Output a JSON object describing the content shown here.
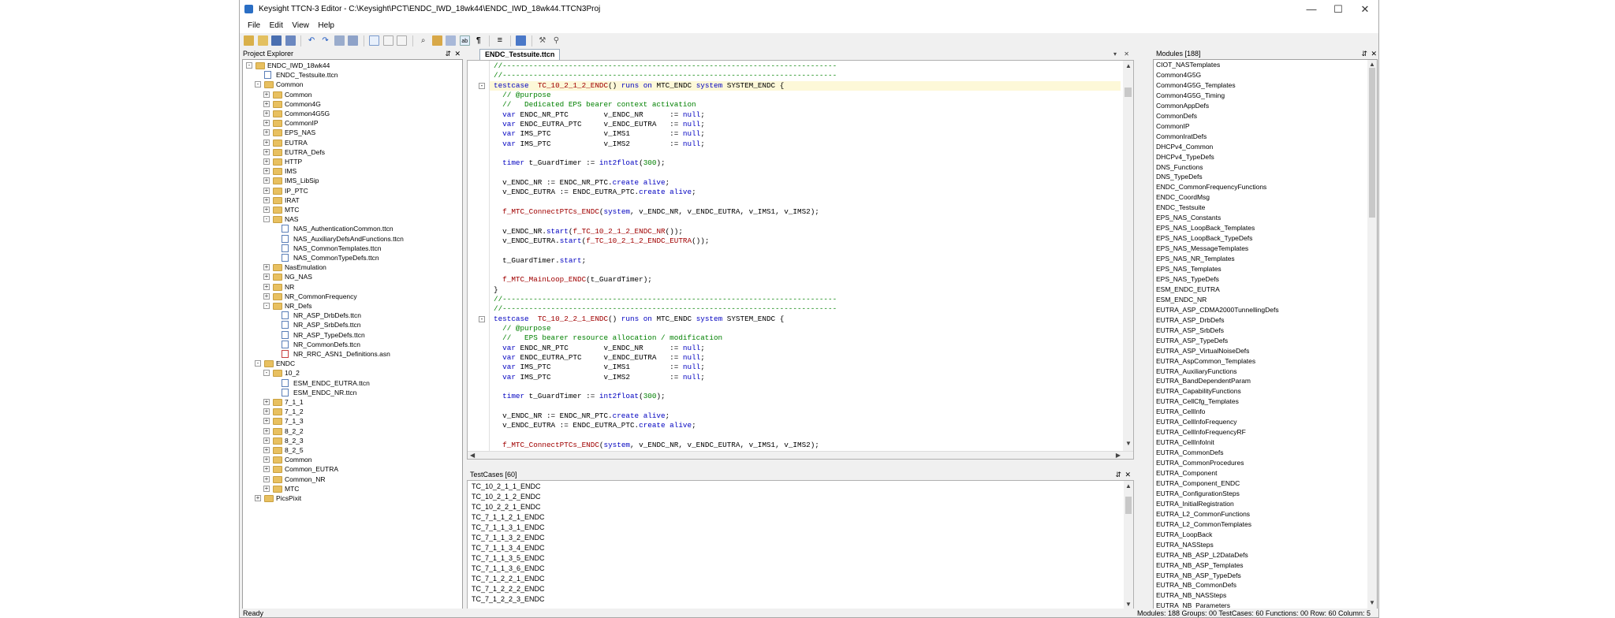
{
  "window": {
    "title": "Keysight TTCN-3 Editor - C:\\Keysight\\PCT\\ENDC_IWD_18wk44\\ENDC_IWD_18wk44.TTCN3Proj"
  },
  "menu": [
    "File",
    "Edit",
    "View",
    "Help"
  ],
  "project_explorer": {
    "title": "Project Explorer",
    "pin": "⇵",
    "close": "✕",
    "nodes": [
      {
        "label": "ENDC_IWD_18wk44",
        "depth": 0,
        "kind": "folder",
        "exp": "-"
      },
      {
        "label": "ENDC_Testsuite.ttcn",
        "depth": 1,
        "kind": "file",
        "exp": ""
      },
      {
        "label": "Common",
        "depth": 1,
        "kind": "folder",
        "exp": "-"
      },
      {
        "label": "Common",
        "depth": 2,
        "kind": "folder",
        "exp": "+"
      },
      {
        "label": "Common4G",
        "depth": 2,
        "kind": "folder",
        "exp": "+"
      },
      {
        "label": "Common4G5G",
        "depth": 2,
        "kind": "folder",
        "exp": "+"
      },
      {
        "label": "CommonIP",
        "depth": 2,
        "kind": "folder",
        "exp": "+"
      },
      {
        "label": "EPS_NAS",
        "depth": 2,
        "kind": "folder",
        "exp": "+"
      },
      {
        "label": "EUTRA",
        "depth": 2,
        "kind": "folder",
        "exp": "+"
      },
      {
        "label": "EUTRA_Defs",
        "depth": 2,
        "kind": "folder",
        "exp": "+"
      },
      {
        "label": "HTTP",
        "depth": 2,
        "kind": "folder",
        "exp": "+"
      },
      {
        "label": "IMS",
        "depth": 2,
        "kind": "folder",
        "exp": "+"
      },
      {
        "label": "IMS_LibSip",
        "depth": 2,
        "kind": "folder",
        "exp": "+"
      },
      {
        "label": "IP_PTC",
        "depth": 2,
        "kind": "folder",
        "exp": "+"
      },
      {
        "label": "IRAT",
        "depth": 2,
        "kind": "folder",
        "exp": "+"
      },
      {
        "label": "MTC",
        "depth": 2,
        "kind": "folder",
        "exp": "+"
      },
      {
        "label": "NAS",
        "depth": 2,
        "kind": "folder",
        "exp": "-"
      },
      {
        "label": "NAS_AuthenticationCommon.ttcn",
        "depth": 3,
        "kind": "file",
        "exp": ""
      },
      {
        "label": "NAS_AuxiliaryDefsAndFunctions.ttcn",
        "depth": 3,
        "kind": "file",
        "exp": ""
      },
      {
        "label": "NAS_CommonTemplates.ttcn",
        "depth": 3,
        "kind": "file",
        "exp": ""
      },
      {
        "label": "NAS_CommonTypeDefs.ttcn",
        "depth": 3,
        "kind": "file",
        "exp": ""
      },
      {
        "label": "NasEmulation",
        "depth": 2,
        "kind": "folder",
        "exp": "+"
      },
      {
        "label": "NG_NAS",
        "depth": 2,
        "kind": "folder",
        "exp": "+"
      },
      {
        "label": "NR",
        "depth": 2,
        "kind": "folder",
        "exp": "+"
      },
      {
        "label": "NR_CommonFrequency",
        "depth": 2,
        "kind": "folder",
        "exp": "+"
      },
      {
        "label": "NR_Defs",
        "depth": 2,
        "kind": "folder",
        "exp": "-"
      },
      {
        "label": "NR_ASP_DrbDefs.ttcn",
        "depth": 3,
        "kind": "file",
        "exp": ""
      },
      {
        "label": "NR_ASP_SrbDefs.ttcn",
        "depth": 3,
        "kind": "file",
        "exp": ""
      },
      {
        "label": "NR_ASP_TypeDefs.ttcn",
        "depth": 3,
        "kind": "file",
        "exp": ""
      },
      {
        "label": "NR_CommonDefs.ttcn",
        "depth": 3,
        "kind": "file",
        "exp": ""
      },
      {
        "label": "NR_RRC_ASN1_Definitions.asn",
        "depth": 3,
        "kind": "asn",
        "exp": ""
      },
      {
        "label": "ENDC",
        "depth": 1,
        "kind": "folder",
        "exp": "-"
      },
      {
        "label": "10_2",
        "depth": 2,
        "kind": "folder",
        "exp": "-"
      },
      {
        "label": "ESM_ENDC_EUTRA.ttcn",
        "depth": 3,
        "kind": "file",
        "exp": ""
      },
      {
        "label": "ESM_ENDC_NR.ttcn",
        "depth": 3,
        "kind": "file",
        "exp": ""
      },
      {
        "label": "7_1_1",
        "depth": 2,
        "kind": "folder",
        "exp": "+"
      },
      {
        "label": "7_1_2",
        "depth": 2,
        "kind": "folder",
        "exp": "+"
      },
      {
        "label": "7_1_3",
        "depth": 2,
        "kind": "folder",
        "exp": "+"
      },
      {
        "label": "8_2_2",
        "depth": 2,
        "kind": "folder",
        "exp": "+"
      },
      {
        "label": "8_2_3",
        "depth": 2,
        "kind": "folder",
        "exp": "+"
      },
      {
        "label": "8_2_5",
        "depth": 2,
        "kind": "folder",
        "exp": "+"
      },
      {
        "label": "Common",
        "depth": 2,
        "kind": "folder",
        "exp": "+"
      },
      {
        "label": "Common_EUTRA",
        "depth": 2,
        "kind": "folder",
        "exp": "+"
      },
      {
        "label": "Common_NR",
        "depth": 2,
        "kind": "folder",
        "exp": "+"
      },
      {
        "label": "MTC",
        "depth": 2,
        "kind": "folder",
        "exp": "+"
      },
      {
        "label": "PicsPixit",
        "depth": 1,
        "kind": "folder",
        "exp": "+"
      }
    ]
  },
  "editor": {
    "tab": "ENDC_Testsuite.ttcn",
    "tab_dropdown": "▾",
    "tab_close": "✕",
    "lines": [
      [
        [
          "cm",
          "//----------------------------------------------------------------------------"
        ]
      ],
      [
        [
          "cm",
          "//----------------------------------------------------------------------------"
        ]
      ],
      [
        [
          "kw",
          "testcase"
        ],
        [
          "",
          "  "
        ],
        [
          "fn",
          "TC_10_2_1_2_ENDC"
        ],
        [
          "",
          "() "
        ],
        [
          "kw",
          "runs on"
        ],
        [
          "",
          ""
        ],
        [
          "kw",
          " "
        ],
        [
          "",
          "MTC_ENDC "
        ],
        [
          "kw",
          "system"
        ],
        [
          "",
          " SYSTEM_ENDC {"
        ]
      ],
      [
        [
          "cm",
          "  // @purpose"
        ]
      ],
      [
        [
          "cm",
          "  //   Dedicated EPS bearer context activation"
        ]
      ],
      [
        [
          "kw",
          "  var"
        ],
        [
          "",
          " ENDC_NR_PTC        v_ENDC_NR      := "
        ],
        [
          "kw",
          "null"
        ],
        [
          "",
          ";"
        ]
      ],
      [
        [
          "kw",
          "  var"
        ],
        [
          "",
          " ENDC_EUTRA_PTC     v_ENDC_EUTRA   := "
        ],
        [
          "kw",
          "null"
        ],
        [
          "",
          ";"
        ]
      ],
      [
        [
          "kw",
          "  var"
        ],
        [
          "",
          " IMS_PTC            v_IMS1         := "
        ],
        [
          "kw",
          "null"
        ],
        [
          "",
          ";"
        ]
      ],
      [
        [
          "kw",
          "  var"
        ],
        [
          "",
          " IMS_PTC            v_IMS2         := "
        ],
        [
          "kw",
          "null"
        ],
        [
          "",
          ";"
        ]
      ],
      [
        [
          "",
          ""
        ]
      ],
      [
        [
          "kw",
          "  timer"
        ],
        [
          "",
          " t_GuardTimer := "
        ],
        [
          "kw",
          "int2float"
        ],
        [
          "",
          "("
        ],
        [
          "cm",
          "300"
        ],
        [
          "",
          ");"
        ]
      ],
      [
        [
          "",
          ""
        ]
      ],
      [
        [
          "",
          "  v_ENDC_NR := ENDC_NR_PTC."
        ],
        [
          "kw",
          "create alive"
        ],
        [
          "",
          ";"
        ]
      ],
      [
        [
          "",
          "  v_ENDC_EUTRA := ENDC_EUTRA_PTC."
        ],
        [
          "kw",
          "create alive"
        ],
        [
          "",
          ";"
        ]
      ],
      [
        [
          "",
          ""
        ]
      ],
      [
        [
          "fn",
          "  f_MTC_ConnectPTCs_ENDC"
        ],
        [
          "",
          "("
        ],
        [
          "kw",
          "system"
        ],
        [
          "",
          ", v_ENDC_NR, v_ENDC_EUTRA, v_IMS1, v_IMS2);"
        ]
      ],
      [
        [
          "",
          ""
        ]
      ],
      [
        [
          "",
          "  v_ENDC_NR."
        ],
        [
          "kw",
          "start"
        ],
        [
          "",
          "("
        ],
        [
          "fn",
          "f_TC_10_2_1_2_ENDC_NR"
        ],
        [
          "",
          "());"
        ]
      ],
      [
        [
          "",
          "  v_ENDC_EUTRA."
        ],
        [
          "kw",
          "start"
        ],
        [
          "",
          "("
        ],
        [
          "fn",
          "f_TC_10_2_1_2_ENDC_EUTRA"
        ],
        [
          "",
          "());"
        ]
      ],
      [
        [
          "",
          ""
        ]
      ],
      [
        [
          "",
          "  t_GuardTimer."
        ],
        [
          "kw",
          "start"
        ],
        [
          "",
          ";"
        ]
      ],
      [
        [
          "",
          ""
        ]
      ],
      [
        [
          "fn",
          "  f_MTC_MainLoop_ENDC"
        ],
        [
          "",
          "(t_GuardTimer);"
        ]
      ],
      [
        [
          "",
          "}"
        ]
      ],
      [
        [
          "cm",
          "//----------------------------------------------------------------------------"
        ]
      ],
      [
        [
          "cm",
          "//----------------------------------------------------------------------------"
        ]
      ],
      [
        [
          "kw",
          "testcase"
        ],
        [
          "",
          "  "
        ],
        [
          "fn",
          "TC_10_2_2_1_ENDC"
        ],
        [
          "",
          "() "
        ],
        [
          "kw",
          "runs on"
        ],
        [
          "",
          " MTC_ENDC "
        ],
        [
          "kw",
          "system"
        ],
        [
          "",
          " SYSTEM_ENDC {"
        ]
      ],
      [
        [
          "cm",
          "  // @purpose"
        ]
      ],
      [
        [
          "cm",
          "  //   EPS bearer resource allocation / modification"
        ]
      ],
      [
        [
          "kw",
          "  var"
        ],
        [
          "",
          " ENDC_NR_PTC        v_ENDC_NR      := "
        ],
        [
          "kw",
          "null"
        ],
        [
          "",
          ";"
        ]
      ],
      [
        [
          "kw",
          "  var"
        ],
        [
          "",
          " ENDC_EUTRA_PTC     v_ENDC_EUTRA   := "
        ],
        [
          "kw",
          "null"
        ],
        [
          "",
          ";"
        ]
      ],
      [
        [
          "kw",
          "  var"
        ],
        [
          "",
          " IMS_PTC            v_IMS1         := "
        ],
        [
          "kw",
          "null"
        ],
        [
          "",
          ";"
        ]
      ],
      [
        [
          "kw",
          "  var"
        ],
        [
          "",
          " IMS_PTC            v_IMS2         := "
        ],
        [
          "kw",
          "null"
        ],
        [
          "",
          ";"
        ]
      ],
      [
        [
          "",
          ""
        ]
      ],
      [
        [
          "kw",
          "  timer"
        ],
        [
          "",
          " t_GuardTimer := "
        ],
        [
          "kw",
          "int2float"
        ],
        [
          "",
          "("
        ],
        [
          "cm",
          "300"
        ],
        [
          "",
          ");"
        ]
      ],
      [
        [
          "",
          ""
        ]
      ],
      [
        [
          "",
          "  v_ENDC_NR := ENDC_NR_PTC."
        ],
        [
          "kw",
          "create alive"
        ],
        [
          "",
          ";"
        ]
      ],
      [
        [
          "",
          "  v_ENDC_EUTRA := ENDC_EUTRA_PTC."
        ],
        [
          "kw",
          "create alive"
        ],
        [
          "",
          ";"
        ]
      ],
      [
        [
          "",
          ""
        ]
      ],
      [
        [
          "fn",
          "  f_MTC_ConnectPTCs_ENDC"
        ],
        [
          "",
          "("
        ],
        [
          "kw",
          "system"
        ],
        [
          "",
          ", v_ENDC_NR, v_ENDC_EUTRA, v_IMS1, v_IMS2);"
        ]
      ]
    ]
  },
  "testcases": {
    "title": "TestCases [60]",
    "items": [
      "TC_10_2_1_1_ENDC",
      "TC_10_2_1_2_ENDC",
      "TC_10_2_2_1_ENDC",
      "TC_7_1_1_2_1_ENDC",
      "TC_7_1_1_3_1_ENDC",
      "TC_7_1_1_3_2_ENDC",
      "TC_7_1_1_3_4_ENDC",
      "TC_7_1_1_3_5_ENDC",
      "TC_7_1_1_3_6_ENDC",
      "TC_7_1_2_2_1_ENDC",
      "TC_7_1_2_2_2_ENDC",
      "TC_7_1_2_2_3_ENDC"
    ]
  },
  "modules": {
    "title": "Modules [188]",
    "items": [
      "CIOT_NASTemplates",
      "Common4G5G",
      "Common4G5G_Templates",
      "Common4G5G_Timing",
      "CommonAppDefs",
      "CommonDefs",
      "CommonIP",
      "CommonIratDefs",
      "DHCPv4_Common",
      "DHCPv4_TypeDefs",
      "DNS_Functions",
      "DNS_TypeDefs",
      "ENDC_CommonFrequencyFunctions",
      "ENDC_CoordMsg",
      "ENDC_Testsuite",
      "EPS_NAS_Constants",
      "EPS_NAS_LoopBack_Templates",
      "EPS_NAS_LoopBack_TypeDefs",
      "EPS_NAS_MessageTemplates",
      "EPS_NAS_NR_Templates",
      "EPS_NAS_Templates",
      "EPS_NAS_TypeDefs",
      "ESM_ENDC_EUTRA",
      "ESM_ENDC_NR",
      "EUTRA_ASP_CDMA2000TunnellingDefs",
      "EUTRA_ASP_DrbDefs",
      "EUTRA_ASP_SrbDefs",
      "EUTRA_ASP_TypeDefs",
      "EUTRA_ASP_VirtualNoiseDefs",
      "EUTRA_AspCommon_Templates",
      "EUTRA_AuxiliaryFunctions",
      "EUTRA_BandDependentParam",
      "EUTRA_CapabilityFunctions",
      "EUTRA_CellCfg_Templates",
      "EUTRA_CellInfo",
      "EUTRA_CellInfoFrequency",
      "EUTRA_CellInfoFrequencyRF",
      "EUTRA_CellInfoInit",
      "EUTRA_CommonDefs",
      "EUTRA_CommonProcedures",
      "EUTRA_Component",
      "EUTRA_Component_ENDC",
      "EUTRA_ConfigurationSteps",
      "EUTRA_InitialRegistration",
      "EUTRA_L2_CommonFunctions",
      "EUTRA_L2_CommonTemplates",
      "EUTRA_LoopBack",
      "EUTRA_NASSteps",
      "EUTRA_NB_ASP_L2DataDefs",
      "EUTRA_NB_ASP_Templates",
      "EUTRA_NB_ASP_TypeDefs",
      "EUTRA_NB_CommonDefs",
      "EUTRA_NB_NASSteps",
      "EUTRA_NB_Parameters"
    ]
  },
  "status": {
    "left": "Ready",
    "right": "Modules: 188   Groups: 00   TestCases: 60   Functions: 00   Row: 60   Column: 5"
  }
}
